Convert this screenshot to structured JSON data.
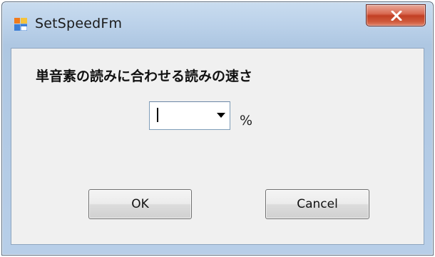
{
  "window": {
    "title": "SetSpeedFm",
    "app_icon": "windows-form-icon",
    "close_icon": "close-icon"
  },
  "form": {
    "label": "単音素の読みに合わせる読みの速さ",
    "speed_combo": {
      "value": "",
      "dropdown_icon": "dropdown-arrow-icon"
    },
    "unit": "%",
    "ok_label": "OK",
    "cancel_label": "Cancel"
  },
  "colors": {
    "close_button": "#c94a2f",
    "client_background": "#f0f0f0",
    "frame": "#b7cee8"
  }
}
